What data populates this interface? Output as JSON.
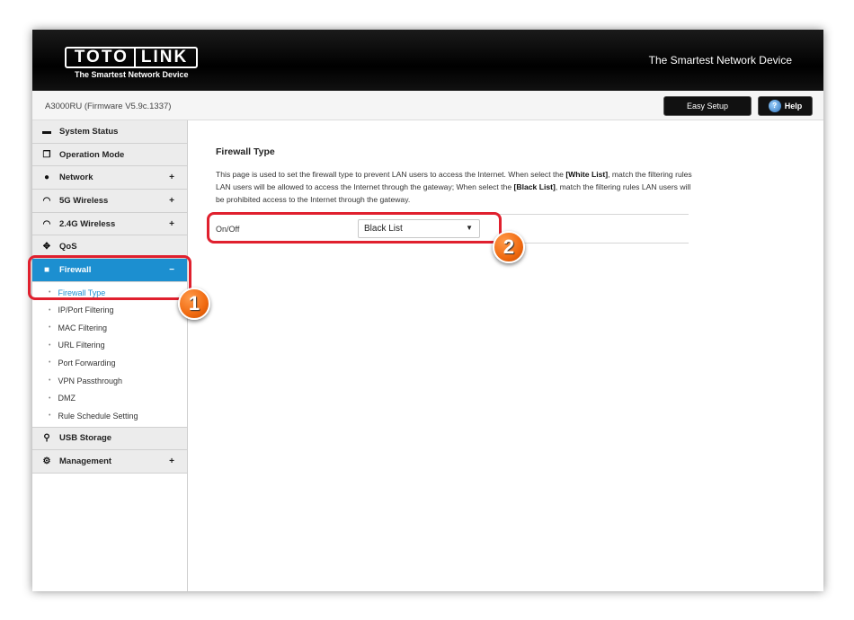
{
  "header": {
    "logo_left": "TOTO",
    "logo_right": "LINK",
    "logo_tagline": "The Smartest Network Device",
    "slogan": "The Smartest Network Device"
  },
  "subbar": {
    "model": "A3000RU (Firmware V5.9c.1337)",
    "easy_setup": "Easy Setup",
    "help": "Help"
  },
  "sidebar": {
    "items": [
      {
        "label": "System Status",
        "icon": "monitor-icon",
        "expandable": false
      },
      {
        "label": "Operation Mode",
        "icon": "windows-icon",
        "expandable": false
      },
      {
        "label": "Network",
        "icon": "globe-icon",
        "expandable": true
      },
      {
        "label": "5G Wireless",
        "icon": "wifi-icon",
        "expandable": true
      },
      {
        "label": "2.4G Wireless",
        "icon": "wifi-icon",
        "expandable": true
      },
      {
        "label": "QoS",
        "icon": "qos-icon",
        "expandable": false
      },
      {
        "label": "Firewall",
        "icon": "lock-icon",
        "expandable": true,
        "active": true
      }
    ],
    "firewall_subitems": [
      "Firewall Type",
      "IP/Port Filtering",
      "MAC Filtering",
      "URL Filtering",
      "Port Forwarding",
      "VPN Passthrough",
      "DMZ",
      "Rule Schedule Setting"
    ],
    "items_after": [
      {
        "label": "USB Storage",
        "icon": "usb-icon",
        "expandable": false
      },
      {
        "label": "Management",
        "icon": "gear-icon",
        "expandable": true
      }
    ],
    "plus_sign": "+",
    "minus_sign": "−"
  },
  "main": {
    "title": "Firewall Type",
    "desc_1": "This page is used to set the firewall type to prevent LAN users to access the Internet. When select the ",
    "desc_b1": "[White List]",
    "desc_2": ", match the filtering rules LAN users will be allowed to access the Internet through the gateway; When select the ",
    "desc_b2": "[Black List]",
    "desc_3": ", match the filtering rules LAN users will be prohibited access to the Internet through the gateway.",
    "row_label": "On/Off",
    "select_value": "Black List"
  },
  "annotations": {
    "badge_1": "1",
    "badge_2": "2",
    "highlight_color": "#e0202e",
    "badge_color": "#f06a10"
  },
  "colors": {
    "accent": "#1c8fd0",
    "header_bg": "#000000"
  }
}
